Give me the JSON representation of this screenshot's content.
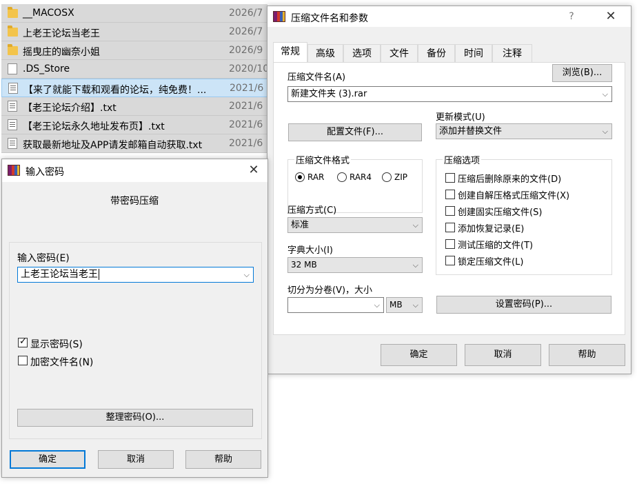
{
  "file_list": [
    {
      "name": "__MACOSX",
      "date": "2026/7",
      "icon": "folder-icon"
    },
    {
      "name": "上老王论坛当老王",
      "date": "2026/7",
      "icon": "folder-icon"
    },
    {
      "name": "摇曳庄的幽奈小姐",
      "date": "2026/9",
      "icon": "folder-icon"
    },
    {
      "name": ".DS_Store",
      "date": "2020/10",
      "icon": "document-icon"
    },
    {
      "name": "【来了就能下载和观看的论坛，纯免费！...",
      "date": "2021/6",
      "icon": "text-file-icon"
    },
    {
      "name": "【老王论坛介绍】.txt",
      "date": "2021/6",
      "icon": "text-file-icon"
    },
    {
      "name": "【老王论坛永久地址发布页】.txt",
      "date": "2021/6",
      "icon": "text-file-icon"
    },
    {
      "name": "获取最新地址及APP请发邮箱自动获取.txt",
      "date": "2021/6",
      "icon": "text-file-icon"
    }
  ],
  "archive_dialog": {
    "title": "压缩文件名和参数",
    "help_glyph": "?",
    "close_glyph": "✕",
    "tabs": [
      "常规",
      "高级",
      "选项",
      "文件",
      "备份",
      "时间",
      "注释"
    ],
    "archive_name_label": "压缩文件名(A)",
    "browse_button": "浏览(B)...",
    "archive_name_value": "新建文件夹 (3).rar",
    "update_mode_label": "更新模式(U)",
    "profiles_button": "配置文件(F)...",
    "update_mode_value": "添加并替换文件",
    "format_group_label": "压缩文件格式",
    "format_options": [
      "RAR",
      "RAR4",
      "ZIP"
    ],
    "format_selected": "RAR",
    "compression_method_label": "压缩方式(C)",
    "compression_method_value": "标准",
    "dictionary_size_label": "字典大小(I)",
    "dictionary_size_value": "32 MB",
    "split_label": "切分为分卷(V)，大小",
    "split_value": "",
    "split_unit_value": "MB",
    "options_group_label": "压缩选项",
    "options": [
      {
        "label": "压缩后删除原来的文件(D)",
        "checked": false
      },
      {
        "label": "创建自解压格式压缩文件(X)",
        "checked": false
      },
      {
        "label": "创建固实压缩文件(S)",
        "checked": false
      },
      {
        "label": "添加恢复记录(E)",
        "checked": false
      },
      {
        "label": "测试压缩的文件(T)",
        "checked": false
      },
      {
        "label": "锁定压缩文件(L)",
        "checked": false
      }
    ],
    "set_password_button": "设置密码(P)...",
    "ok_button": "确定",
    "cancel_button": "取消",
    "help_button": "帮助"
  },
  "password_dialog": {
    "title": "输入密码",
    "close_glyph": "✕",
    "heading": "带密码压缩",
    "password_label": "输入密码(E)",
    "password_value": "上老王论坛当老王",
    "show_password_label": "显示密码(S)",
    "show_password_checked": true,
    "encrypt_names_label": "加密文件名(N)",
    "encrypt_names_checked": false,
    "organize_button": "整理密码(O)...",
    "ok_button": "确定",
    "cancel_button": "取消",
    "help_button": "帮助"
  },
  "colors": {
    "selected_row": "#cce4f7",
    "default_button_border": "#0078d7",
    "dialog_background": "#f0f0f0"
  }
}
